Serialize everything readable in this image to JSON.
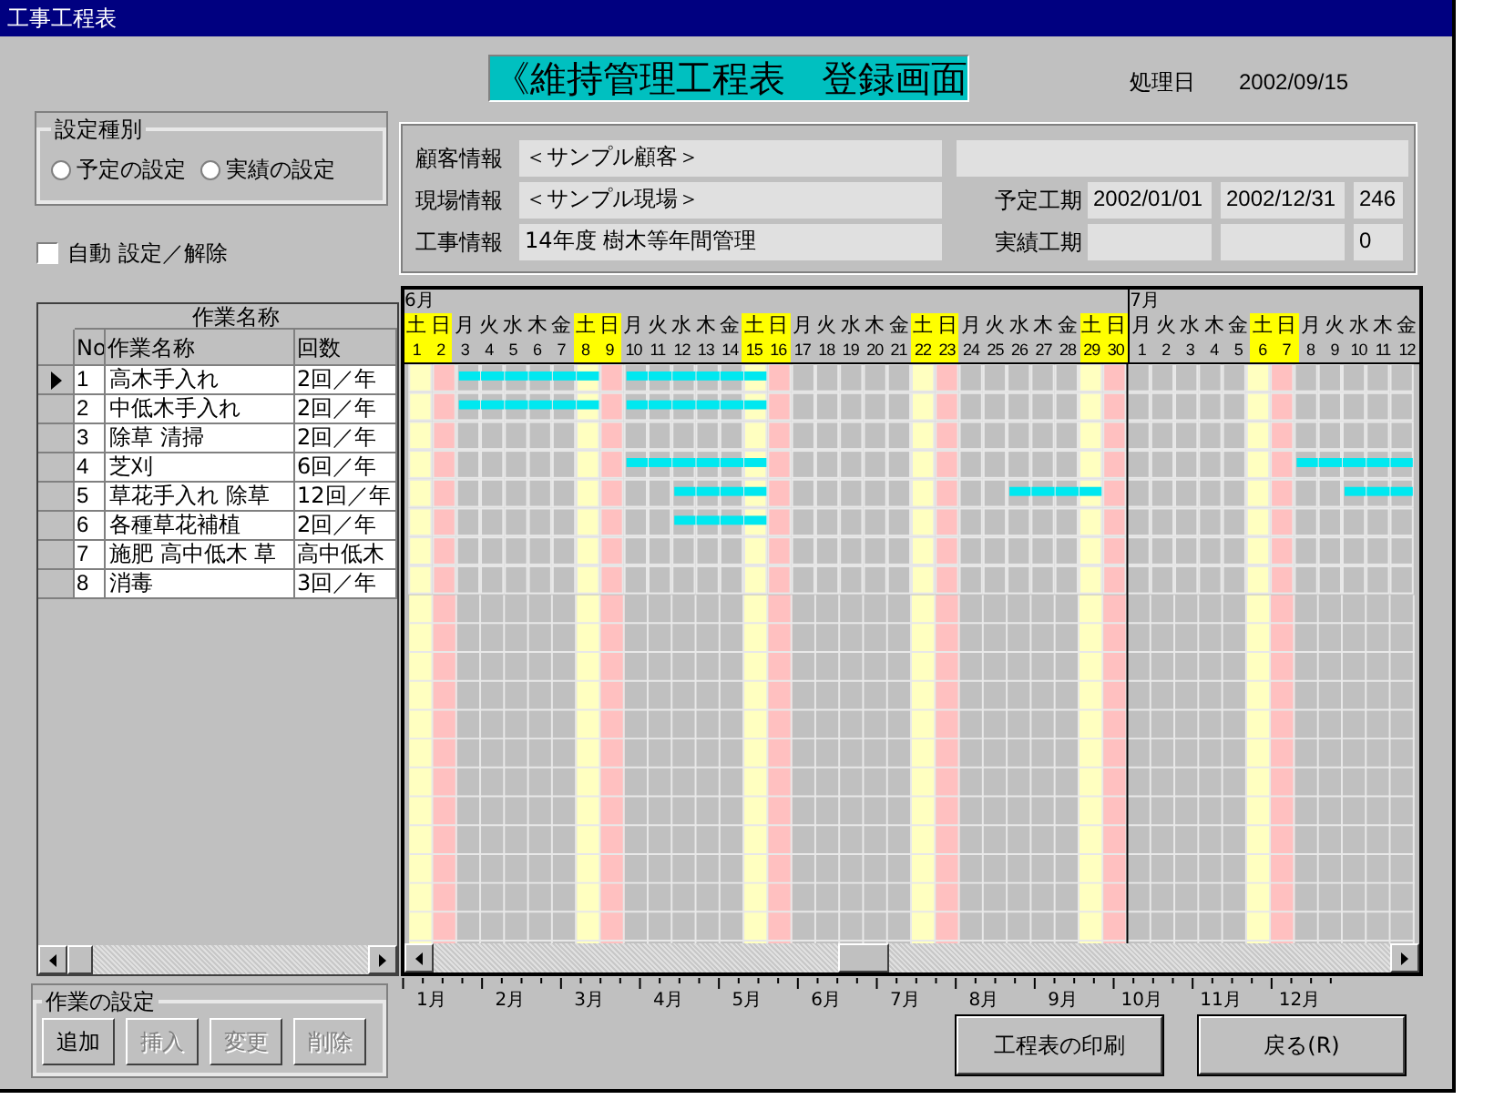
{
  "window": {
    "title": "工事工程表"
  },
  "header": {
    "title": "《維持管理工程表　登録画面",
    "date_label": "処理日",
    "date": "2002/09/15"
  },
  "setting_type": {
    "label": "設定種別",
    "options": [
      {
        "label": "予定の設定",
        "selected": false
      },
      {
        "label": "実績の設定",
        "selected": false
      }
    ]
  },
  "auto_toggle": {
    "label": "自動  設定／解除",
    "checked": false
  },
  "info": {
    "rows": [
      {
        "label": "顧客情報",
        "value": "＜サンプル顧客＞"
      },
      {
        "label": "現場情報",
        "value": "＜サンプル現場＞"
      },
      {
        "label": "工事情報",
        "value": "14年度  樹木等年間管理"
      }
    ],
    "periods": [
      {
        "label": "予定工期",
        "start": "2002/01/01",
        "end": "2002/12/31",
        "days": "246"
      },
      {
        "label": "実績工期",
        "days": "0"
      }
    ]
  },
  "task_table": {
    "title": "作業名称",
    "columns": [
      "No",
      "作業名称",
      "回数"
    ],
    "rows": [
      {
        "no": "1",
        "name": "高木手入れ",
        "count": "2回／年",
        "selected": true,
        "scheduled": [
          false,
          false,
          true,
          true,
          true,
          true,
          true,
          true,
          false,
          true,
          true,
          true,
          true,
          true,
          true,
          false,
          false,
          false,
          false,
          false,
          false,
          false,
          false,
          false,
          false,
          false,
          false,
          false,
          false,
          false,
          false,
          false,
          false,
          false,
          false,
          false,
          false,
          false,
          false,
          false,
          false,
          false
        ]
      },
      {
        "no": "2",
        "name": "中低木手入れ",
        "count": "2回／年",
        "selected": false,
        "scheduled": [
          false,
          false,
          true,
          true,
          true,
          true,
          true,
          true,
          false,
          true,
          true,
          true,
          true,
          true,
          true,
          false,
          false,
          false,
          false,
          false,
          false,
          false,
          false,
          false,
          false,
          false,
          false,
          false,
          false,
          false,
          false,
          false,
          false,
          false,
          false,
          false,
          false,
          false,
          false,
          false,
          false,
          false
        ]
      },
      {
        "no": "3",
        "name": "除草  清掃",
        "count": "2回／年",
        "selected": false,
        "scheduled": [
          false,
          false,
          false,
          false,
          false,
          false,
          false,
          false,
          false,
          false,
          false,
          false,
          false,
          false,
          false,
          false,
          false,
          false,
          false,
          false,
          false,
          false,
          false,
          false,
          false,
          false,
          false,
          false,
          false,
          false,
          false,
          false,
          false,
          false,
          false,
          false,
          false,
          false,
          false,
          false,
          false,
          false
        ]
      },
      {
        "no": "4",
        "name": "芝刈",
        "count": "6回／年",
        "selected": false,
        "scheduled": [
          false,
          false,
          false,
          false,
          false,
          false,
          false,
          false,
          false,
          true,
          true,
          true,
          true,
          true,
          true,
          false,
          false,
          false,
          false,
          false,
          false,
          false,
          false,
          false,
          false,
          false,
          false,
          false,
          false,
          false,
          false,
          false,
          false,
          false,
          false,
          false,
          false,
          true,
          true,
          true,
          true,
          true
        ]
      },
      {
        "no": "5",
        "name": "草花手入れ  除草",
        "count": "12回／年",
        "selected": false,
        "scheduled": [
          false,
          false,
          false,
          false,
          false,
          false,
          false,
          false,
          false,
          false,
          false,
          true,
          true,
          true,
          true,
          false,
          false,
          false,
          false,
          false,
          false,
          false,
          false,
          false,
          false,
          true,
          true,
          true,
          true,
          false,
          false,
          false,
          false,
          false,
          false,
          false,
          false,
          false,
          false,
          true,
          true,
          true
        ]
      },
      {
        "no": "6",
        "name": "各種草花補植",
        "count": "2回／年",
        "selected": false,
        "scheduled": [
          false,
          false,
          false,
          false,
          false,
          false,
          false,
          false,
          false,
          false,
          false,
          true,
          true,
          true,
          true,
          false,
          false,
          false,
          false,
          false,
          false,
          false,
          false,
          false,
          false,
          false,
          false,
          false,
          false,
          false,
          false,
          false,
          false,
          false,
          false,
          false,
          false,
          false,
          false,
          false,
          false,
          false
        ]
      },
      {
        "no": "7",
        "name": "施肥  高中低木  草",
        "count": "高中低木",
        "selected": false,
        "scheduled": [
          false,
          false,
          false,
          false,
          false,
          false,
          false,
          false,
          false,
          false,
          false,
          false,
          false,
          false,
          false,
          false,
          false,
          false,
          false,
          false,
          false,
          false,
          false,
          false,
          false,
          false,
          false,
          false,
          false,
          false,
          false,
          false,
          false,
          false,
          false,
          false,
          false,
          false,
          false,
          false,
          false,
          false
        ]
      },
      {
        "no": "8",
        "name": "消毒",
        "count": "3回／年",
        "selected": false,
        "scheduled": [
          false,
          false,
          false,
          false,
          false,
          false,
          false,
          false,
          false,
          false,
          false,
          false,
          false,
          false,
          false,
          false,
          false,
          false,
          false,
          false,
          false,
          false,
          false,
          false,
          false,
          false,
          false,
          false,
          false,
          false,
          false,
          false,
          false,
          false,
          false,
          false,
          false,
          false,
          false,
          false,
          false,
          false
        ]
      }
    ]
  },
  "calendar": {
    "months": [
      {
        "label": "6月",
        "days": [
          {
            "weekday": "土",
            "day": "1",
            "kind": "saturday"
          },
          {
            "weekday": "日",
            "day": "2",
            "kind": "sunday"
          },
          {
            "weekday": "月",
            "day": "3",
            "kind": "weekday"
          },
          {
            "weekday": "火",
            "day": "4",
            "kind": "weekday"
          },
          {
            "weekday": "水",
            "day": "5",
            "kind": "weekday"
          },
          {
            "weekday": "木",
            "day": "6",
            "kind": "weekday"
          },
          {
            "weekday": "金",
            "day": "7",
            "kind": "weekday"
          },
          {
            "weekday": "土",
            "day": "8",
            "kind": "saturday"
          },
          {
            "weekday": "日",
            "day": "9",
            "kind": "sunday"
          },
          {
            "weekday": "月",
            "day": "10",
            "kind": "weekday"
          },
          {
            "weekday": "火",
            "day": "11",
            "kind": "weekday"
          },
          {
            "weekday": "水",
            "day": "12",
            "kind": "weekday"
          },
          {
            "weekday": "木",
            "day": "13",
            "kind": "weekday"
          },
          {
            "weekday": "金",
            "day": "14",
            "kind": "weekday"
          },
          {
            "weekday": "土",
            "day": "15",
            "kind": "saturday"
          },
          {
            "weekday": "日",
            "day": "16",
            "kind": "sunday"
          },
          {
            "weekday": "月",
            "day": "17",
            "kind": "weekday"
          },
          {
            "weekday": "火",
            "day": "18",
            "kind": "weekday"
          },
          {
            "weekday": "水",
            "day": "19",
            "kind": "weekday"
          },
          {
            "weekday": "木",
            "day": "20",
            "kind": "weekday"
          },
          {
            "weekday": "金",
            "day": "21",
            "kind": "weekday"
          },
          {
            "weekday": "土",
            "day": "22",
            "kind": "saturday"
          },
          {
            "weekday": "日",
            "day": "23",
            "kind": "sunday"
          },
          {
            "weekday": "月",
            "day": "24",
            "kind": "weekday"
          },
          {
            "weekday": "火",
            "day": "25",
            "kind": "weekday"
          },
          {
            "weekday": "水",
            "day": "26",
            "kind": "weekday"
          },
          {
            "weekday": "木",
            "day": "27",
            "kind": "weekday"
          },
          {
            "weekday": "金",
            "day": "28",
            "kind": "weekday"
          },
          {
            "weekday": "土",
            "day": "29",
            "kind": "saturday"
          },
          {
            "weekday": "日",
            "day": "30",
            "kind": "sunday"
          }
        ]
      },
      {
        "label": "7月",
        "days": [
          {
            "weekday": "月",
            "day": "1",
            "kind": "weekday"
          },
          {
            "weekday": "火",
            "day": "2",
            "kind": "weekday"
          },
          {
            "weekday": "水",
            "day": "3",
            "kind": "weekday"
          },
          {
            "weekday": "木",
            "day": "4",
            "kind": "weekday"
          },
          {
            "weekday": "金",
            "day": "5",
            "kind": "weekday"
          },
          {
            "weekday": "土",
            "day": "6",
            "kind": "saturday"
          },
          {
            "weekday": "日",
            "day": "7",
            "kind": "sunday"
          },
          {
            "weekday": "月",
            "day": "8",
            "kind": "weekday"
          },
          {
            "weekday": "火",
            "day": "9",
            "kind": "weekday"
          },
          {
            "weekday": "水",
            "day": "10",
            "kind": "weekday"
          },
          {
            "weekday": "木",
            "day": "11",
            "kind": "weekday"
          },
          {
            "weekday": "金",
            "day": "12",
            "kind": "weekday"
          }
        ]
      }
    ]
  },
  "timeline": {
    "months": [
      "1月",
      "2月",
      "3月",
      "4月",
      "5月",
      "6月",
      "7月",
      "8月",
      "9月",
      "10月",
      "11月",
      "12月"
    ]
  },
  "task_settings": {
    "label": "作業の設定",
    "buttons": [
      {
        "label": "追加",
        "disabled": false
      },
      {
        "label": "挿入",
        "disabled": true
      },
      {
        "label": "変更",
        "disabled": true
      },
      {
        "label": "削除",
        "disabled": true
      }
    ]
  },
  "actions": [
    {
      "label": "工程表の印刷"
    },
    {
      "label": "戻る(R)"
    }
  ]
}
